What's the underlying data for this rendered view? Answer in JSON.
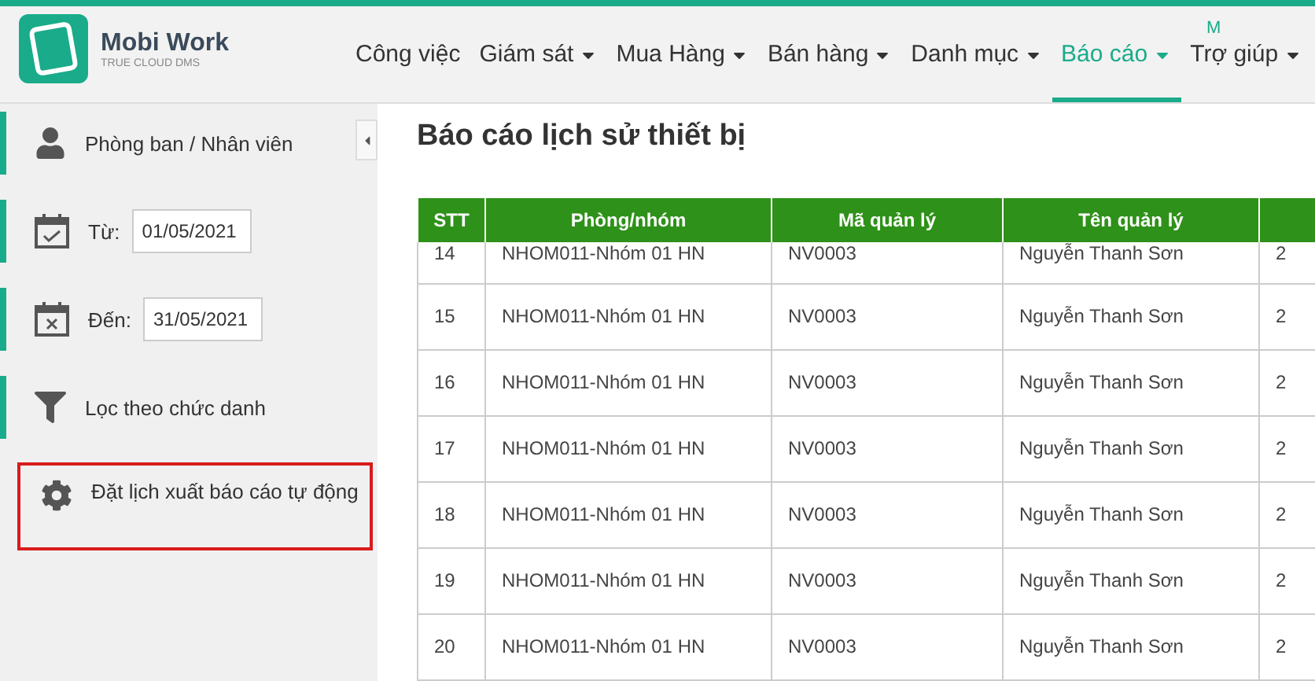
{
  "logo": {
    "name": "Mobi Work",
    "tagline": "TRUE CLOUD DMS"
  },
  "corner_text": "M",
  "nav": [
    {
      "label": "Công việc",
      "dropdown": false,
      "selected": false
    },
    {
      "label": "Giám sát",
      "dropdown": true,
      "selected": false
    },
    {
      "label": "Mua Hàng",
      "dropdown": true,
      "selected": false
    },
    {
      "label": "Bán hàng",
      "dropdown": true,
      "selected": false
    },
    {
      "label": "Danh mục",
      "dropdown": true,
      "selected": false
    },
    {
      "label": "Báo cáo",
      "dropdown": true,
      "selected": true
    },
    {
      "label": "Trợ giúp",
      "dropdown": true,
      "selected": false
    }
  ],
  "sidebar": {
    "items": [
      {
        "kind": "person",
        "label": "Phòng ban / Nhân viên",
        "highlighted": false
      },
      {
        "kind": "date-from",
        "label": "Từ:",
        "value": "01/05/2021",
        "highlighted": false
      },
      {
        "kind": "date-to",
        "label": "Đến:",
        "value": "31/05/2021",
        "highlighted": false
      },
      {
        "kind": "filter",
        "label": "Lọc theo chức danh",
        "highlighted": false
      },
      {
        "kind": "gear",
        "label": "Đặt lịch xuất báo cáo tự động",
        "highlighted": true
      }
    ]
  },
  "page_title": "Báo cáo lịch sử thiết bị",
  "table": {
    "columns": [
      "STT",
      "Phòng/nhóm",
      "Mã quản lý",
      "Tên quản lý",
      ""
    ],
    "rows": [
      [
        "14",
        "NHOM011-Nhóm 01 HN",
        "NV0003",
        "Nguyễn Thanh Sơn",
        "2"
      ],
      [
        "15",
        "NHOM011-Nhóm 01 HN",
        "NV0003",
        "Nguyễn Thanh Sơn",
        "2"
      ],
      [
        "16",
        "NHOM011-Nhóm 01 HN",
        "NV0003",
        "Nguyễn Thanh Sơn",
        "2"
      ],
      [
        "17",
        "NHOM011-Nhóm 01 HN",
        "NV0003",
        "Nguyễn Thanh Sơn",
        "2"
      ],
      [
        "18",
        "NHOM011-Nhóm 01 HN",
        "NV0003",
        "Nguyễn Thanh Sơn",
        "2"
      ],
      [
        "19",
        "NHOM011-Nhóm 01 HN",
        "NV0003",
        "Nguyễn Thanh Sơn",
        "2"
      ],
      [
        "20",
        "NHOM011-Nhóm 01 HN",
        "NV0003",
        "Nguyễn Thanh Sơn",
        "2"
      ]
    ]
  }
}
